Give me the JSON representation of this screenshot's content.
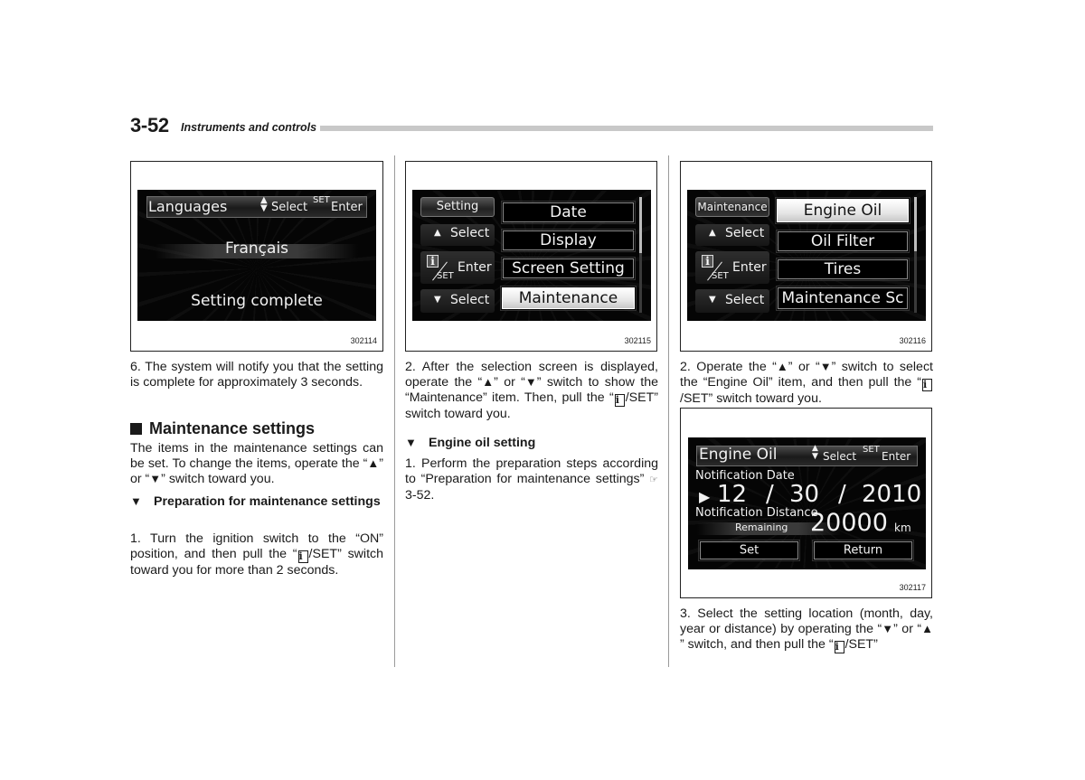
{
  "header": {
    "page_number": "3-52",
    "section_title": "Instruments and controls"
  },
  "figures": {
    "fig1": {
      "code": "302114",
      "title": "Languages",
      "select_label": "Select",
      "set_label": "SET",
      "enter_label": "Enter",
      "arrows_icon": "up-down-arrows",
      "value": "Français",
      "status": "Setting complete"
    },
    "fig2": {
      "code": "302115",
      "side_header": "Setting",
      "up_select": "Select",
      "enter_label": "Enter",
      "set_label": "SET",
      "info_glyph": "i",
      "down_select": "Select",
      "up_glyph": "▲",
      "down_glyph": "▼",
      "items": [
        "Date",
        "Display",
        "Screen Setting",
        "Maintenance"
      ],
      "selected_index": 3
    },
    "fig3": {
      "code": "302116",
      "side_header": "Maintenance",
      "up_select": "Select",
      "enter_label": "Enter",
      "set_label": "SET",
      "info_glyph": "i",
      "down_select": "Select",
      "up_glyph": "▲",
      "down_glyph": "▼",
      "items": [
        "Engine Oil",
        "Oil Filter",
        "Tires",
        "Maintenance Sc"
      ],
      "selected_index": 0
    },
    "fig4": {
      "code": "302117",
      "title": "Engine Oil",
      "select_label": "Select",
      "set_label": "SET",
      "enter_label": "Enter",
      "date_label": "Notification Date",
      "cursor_glyph": "▶",
      "month": "12",
      "day": "30",
      "year": "2010",
      "separator": "/",
      "distance_label": "Notification Distance",
      "remaining_label": "Remaining",
      "distance_value": "20000",
      "distance_unit": "km",
      "set_button": "Set",
      "return_button": "Return"
    }
  },
  "col1": {
    "step6": "6. The system will notify you that the setting is complete for approximately 3 seconds.",
    "heading": "Maintenance settings",
    "intro_a": "The items in the maintenance settings can be set. To change the items, operate the “",
    "intro_up": "▲",
    "intro_b": "” or “",
    "intro_down": "▼",
    "intro_c": "” switch toward you.",
    "subheading_bullet": "▼",
    "subheading": "Preparation for maintenance settings",
    "step1_a": "1. Turn the ignition switch to the “ON” position, and then pull the “",
    "step1_icon": "i",
    "step1_b": "/SET” switch toward you for more than 2 seconds."
  },
  "col2": {
    "step2_a": "2. After the selection screen is displayed, operate the “",
    "step2_up": "▲",
    "step2_b": "” or “",
    "step2_down": "▼",
    "step2_c": "” switch to show the “Maintenance” item. Then, pull the “",
    "step2_icon": "i",
    "step2_d": "/SET” switch toward you.",
    "subheading_bullet": "▼",
    "subheading": "Engine oil setting",
    "step1_a": "1. Perform the preparation steps according to “Preparation for maintenance settings” ",
    "ref_icon": "☞",
    "step1_ref": "3-52."
  },
  "col3": {
    "step2_a": "2. Operate the “",
    "step2_up": "▲",
    "step2_b": "” or “",
    "step2_down": "▼",
    "step2_c": "” switch to select the “Engine Oil” item, and then pull the “",
    "step2_icon": "i",
    "step2_d": "/SET” switch toward you.",
    "step3_a": "3. Select the setting location (month, day, year or distance) by operating the “",
    "step3_down": "▼",
    "step3_b": "” or “",
    "step3_up": "▲",
    "step3_c": "” switch, and then pull the “",
    "step3_icon": "i",
    "step3_d": "/SET”"
  }
}
